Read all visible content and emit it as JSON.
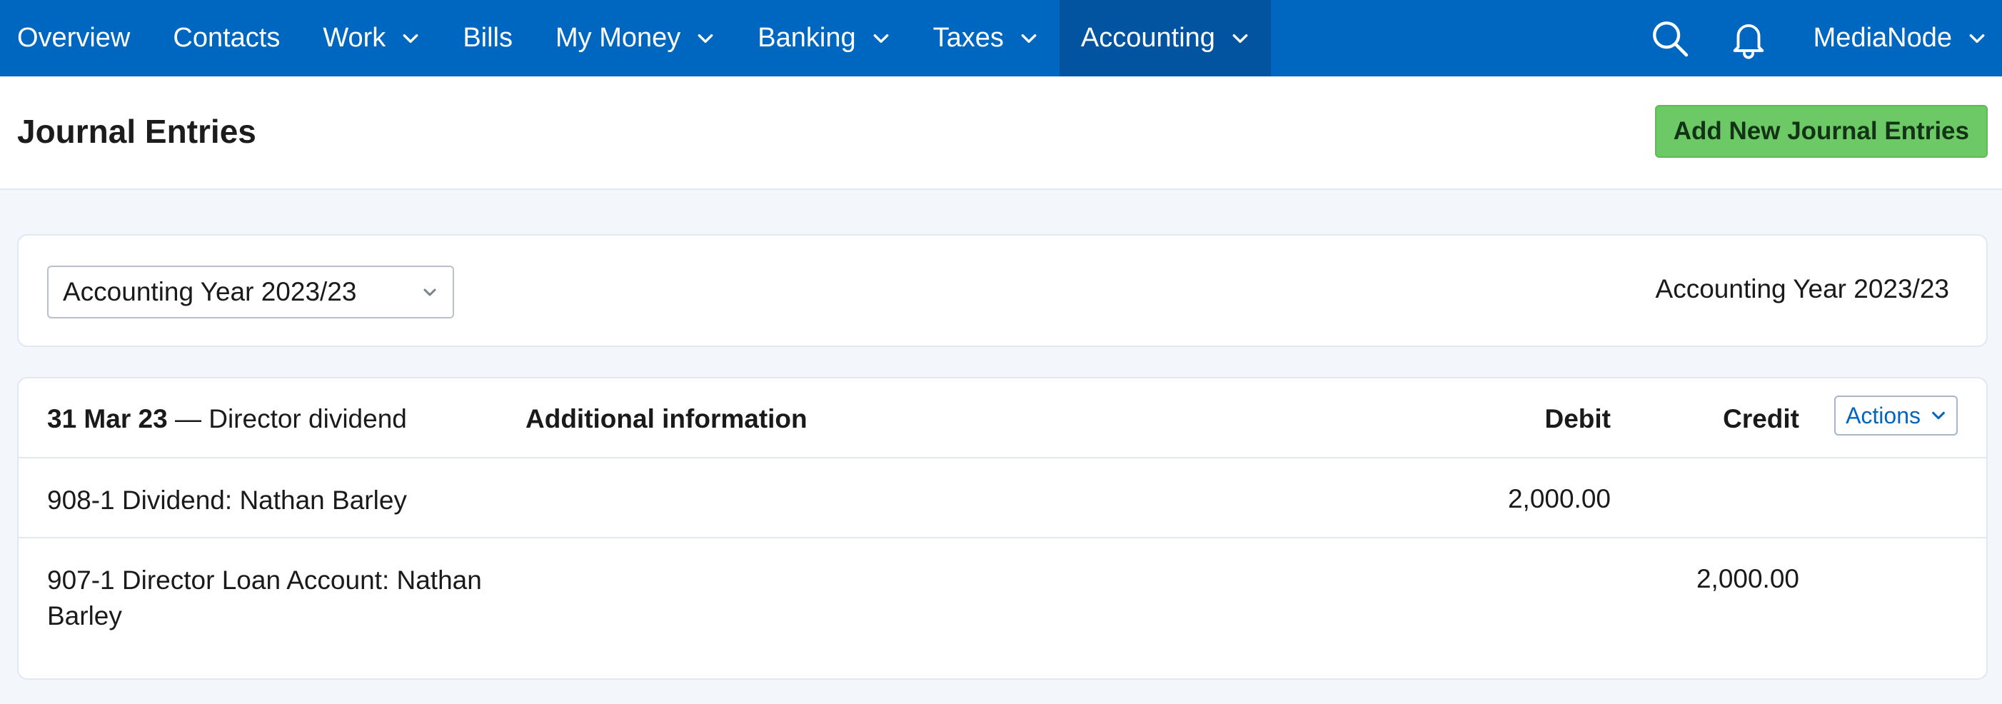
{
  "nav": {
    "items": [
      {
        "label": "Overview"
      },
      {
        "label": "Contacts"
      },
      {
        "label": "Work"
      },
      {
        "label": "Bills"
      },
      {
        "label": "My Money"
      },
      {
        "label": "Banking"
      },
      {
        "label": "Taxes"
      },
      {
        "label": "Accounting"
      }
    ],
    "active": "Accounting",
    "account_name": "MediaNode",
    "icons": [
      "search-icon",
      "bell-icon"
    ]
  },
  "header": {
    "title": "Journal Entries",
    "add_button": "Add New Journal Entries"
  },
  "filter": {
    "selected_year": "Accounting Year 2023/23",
    "current_year_label": "Accounting Year 2023/23"
  },
  "journal": {
    "date": "31 Mar 23",
    "separator": "—",
    "description": "Director dividend",
    "columns": {
      "info": "Additional information",
      "debit": "Debit",
      "credit": "Credit"
    },
    "actions_label": "Actions",
    "rows": [
      {
        "account": "908-1 Dividend: Nathan Barley",
        "debit": "2,000.00",
        "credit": ""
      },
      {
        "account": "907-1 Director Loan Account: Nathan Barley",
        "debit": "",
        "credit": "2,000.00"
      }
    ]
  },
  "colors": {
    "nav_bg": "#0067c1",
    "nav_active": "#0354a0",
    "add_button": "#6cc965",
    "link": "#0067c1"
  }
}
